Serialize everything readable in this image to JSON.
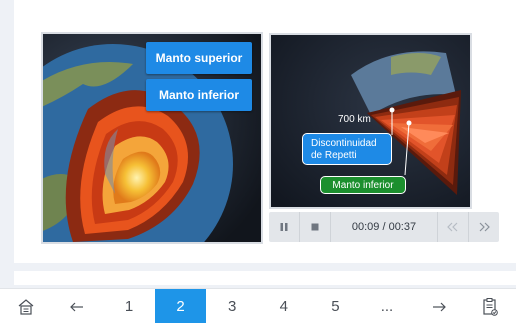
{
  "image_panel": {
    "labels": [
      "Manto superior",
      "Manto inferior"
    ]
  },
  "video": {
    "depth_label": "700 km",
    "callout_blue": "Discontinuidad de Repetti",
    "callout_green": "Manto inferior",
    "time": "00:09 / 00:37"
  },
  "nav": {
    "pages": [
      "1",
      "2",
      "3",
      "4",
      "5",
      "..."
    ],
    "active_page": "2"
  },
  "colors": {
    "accent": "#1e8ae6",
    "active_nav": "#1e95e8",
    "green": "#1c8f2e"
  },
  "icons": [
    "home-icon",
    "arrow-left-icon",
    "arrow-right-icon",
    "clipboard-icon",
    "pause-icon",
    "stop-icon",
    "rewind-icon",
    "forward-icon"
  ]
}
